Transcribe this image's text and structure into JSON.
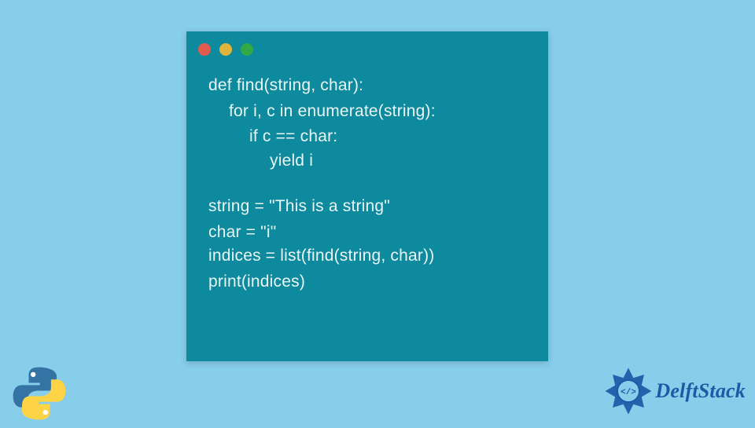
{
  "code": {
    "lines": [
      {
        "indent": 0,
        "text": "def find(string, char):"
      },
      {
        "indent": 1,
        "text": "for i, c in enumerate(string):"
      },
      {
        "indent": 2,
        "text": "if c == char:"
      },
      {
        "indent": 3,
        "text": "yield i"
      },
      {
        "indent": -1,
        "text": ""
      },
      {
        "indent": 0,
        "text": "string = \"This is a string\""
      },
      {
        "indent": 0,
        "text": "char = \"i\""
      },
      {
        "indent": 0,
        "text": "indices = list(find(string, char))"
      },
      {
        "indent": 0,
        "text": "print(indices)"
      }
    ]
  },
  "branding": {
    "site_name": "DelftStack"
  },
  "colors": {
    "background": "#87ceeb",
    "panel": "#0e8a9e",
    "code_text": "#e9f6f9",
    "dot_red": "#e05b4c",
    "dot_yellow": "#e0b43a",
    "dot_green": "#33a946",
    "logo_blue": "#3673a5",
    "logo_yellow": "#ffd346",
    "delft_blue": "#1b5ba6"
  }
}
